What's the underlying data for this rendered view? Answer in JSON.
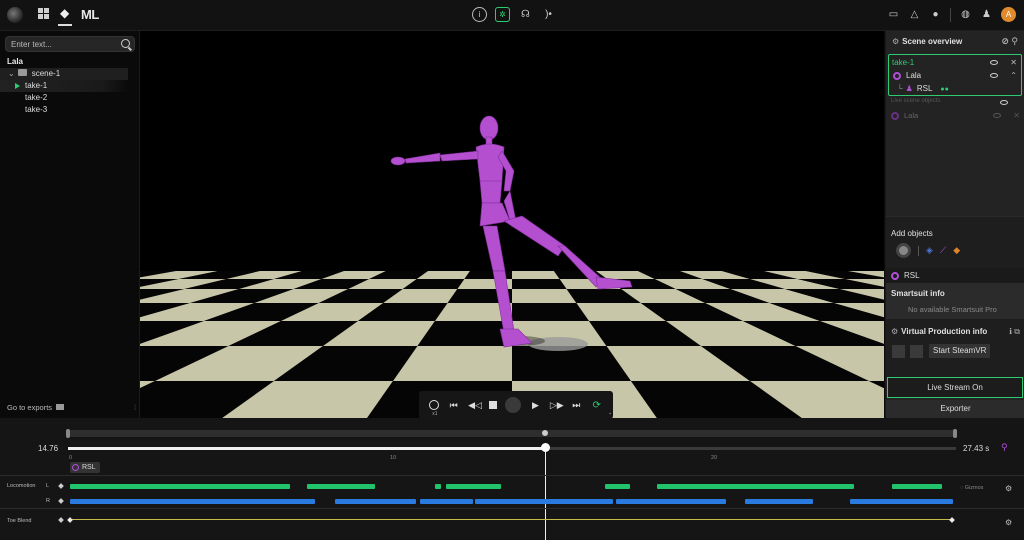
{
  "topbar": {
    "left_icons": [
      "logo-icon",
      "grid-icon",
      "layers-icon"
    ],
    "brand": "ML",
    "center_icons": [
      "info-icon",
      "motion-capture-icon",
      "headphones-icon",
      "stream-icon"
    ],
    "right_icons": [
      "monitor-icon",
      "warning-icon",
      "circle-icon",
      "globe-icon",
      "person-icon"
    ],
    "avatar_initial": "A"
  },
  "left_panel": {
    "search_placeholder": "Enter text...",
    "actor_name": "Lala",
    "scene": "scene-1",
    "takes": [
      "take-1",
      "take-2",
      "take-3"
    ],
    "selected_take": "take-1",
    "exports_label": "Go to exports"
  },
  "transport": {
    "speed": "x1",
    "buttons": [
      "clock-icon",
      "skip-start-icon",
      "step-back-icon",
      "stop-icon",
      "record-icon",
      "play-icon",
      "step-forward-icon",
      "skip-end-icon",
      "loop-icon"
    ]
  },
  "right_panel": {
    "title": "Scene overview",
    "take_title": "take-1",
    "take_actor": "Lala",
    "take_suit": "RSL",
    "live_objects_label": "Live scene objects",
    "live_actor": "Lala",
    "add_objects_label": "Add objects",
    "rsl_label": "RSL",
    "smartsuit_title": "Smartsuit info",
    "smartsuit_msg": "No available Smartsuit Pro",
    "vp_title": "Virtual Production info",
    "steamvr_label": "Start SteamVR",
    "live_stream_label": "Live Stream On",
    "exporter_label": "Exporter"
  },
  "timeline": {
    "current_time": "14.76",
    "total_time": "27.43 s",
    "ticks": [
      "0",
      "10",
      "20"
    ],
    "clip_label": "RSL",
    "locomotion_label": "Locomotion",
    "left_label": "L",
    "right_label": "R",
    "gizmos_label": "Gizmos",
    "toe_blend_label": "Toe Blend",
    "accent_green": "#21c46a",
    "accent_blue": "#2a7be0",
    "accent_purple": "#b04fd6",
    "playhead_fraction": 0.538
  }
}
